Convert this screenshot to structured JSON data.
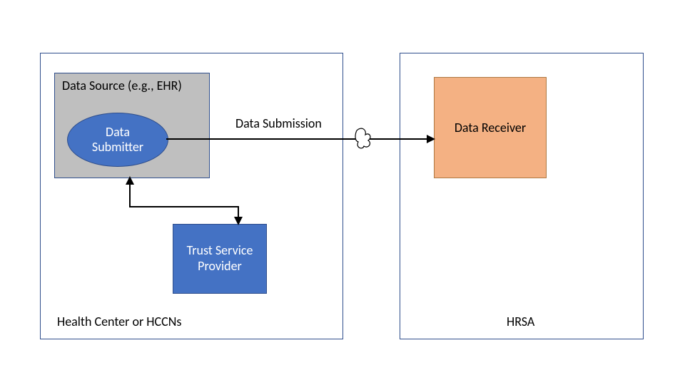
{
  "left_container": {
    "label": "Health Center or HCCNs"
  },
  "right_container": {
    "label": "HRSA"
  },
  "data_source": {
    "title": "Data Source (e.g., EHR)",
    "submitter_label": "Data\nSubmitter"
  },
  "trust_service": {
    "label": "Trust Service\nProvider"
  },
  "receiver": {
    "label": "Data Receiver"
  },
  "submission_label": "Data Submission"
}
